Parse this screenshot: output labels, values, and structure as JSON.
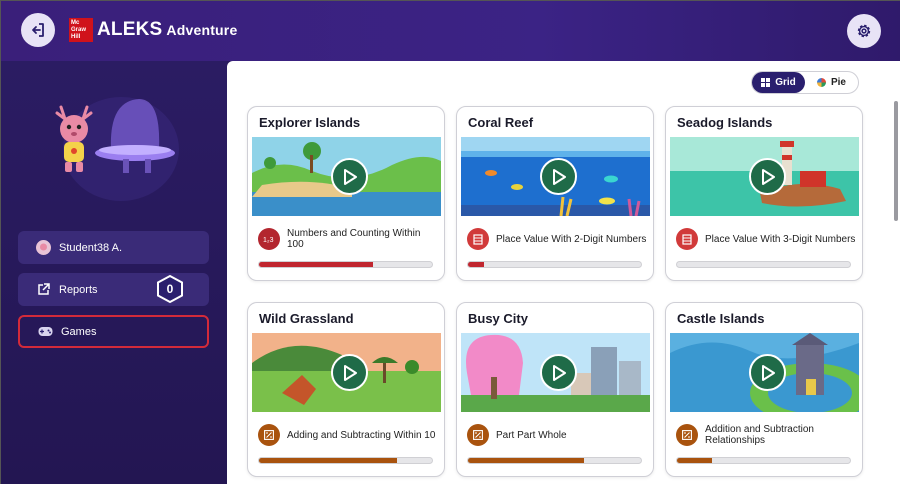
{
  "header": {
    "logo_text": "Mc Graw Hill",
    "app_name": "ALEKS",
    "app_suffix": "Adventure",
    "exit_icon": "exit-icon",
    "settings_icon": "gear-icon"
  },
  "sidebar": {
    "student_name": "Student38 A.",
    "reports_label": "Reports",
    "reports_count": "0",
    "games_label": "Games"
  },
  "view_toggle": {
    "grid_label": "Grid",
    "pie_label": "Pie",
    "selected": "Grid"
  },
  "cards": [
    {
      "title": "Explorer Islands",
      "skill": "Numbers and Counting Within 100",
      "progress": 0.66,
      "color": "#c0262f"
    },
    {
      "title": "Coral Reef",
      "skill": "Place Value With 2-Digit Numbers",
      "progress": 0.09,
      "color": "#c0262f"
    },
    {
      "title": "Seadog Islands",
      "skill": "Place Value With 3-Digit Numbers",
      "progress": 0.0,
      "color": "#c0262f"
    },
    {
      "title": "Wild Grassland",
      "skill": "Adding and Subtracting Within 10",
      "progress": 0.8,
      "color": "#a9530e"
    },
    {
      "title": "Busy City",
      "skill": "Part Part Whole",
      "progress": 0.67,
      "color": "#a9530e"
    },
    {
      "title": "Castle Islands",
      "skill": "Addition and Subtraction Relationships",
      "progress": 0.2,
      "color": "#a9530e"
    }
  ],
  "colors": {
    "header_bg": "#3a1f7a",
    "sidebar_bg": "#2b1c63",
    "active_border": "#d32a3a",
    "play_button": "#1f6b48"
  }
}
